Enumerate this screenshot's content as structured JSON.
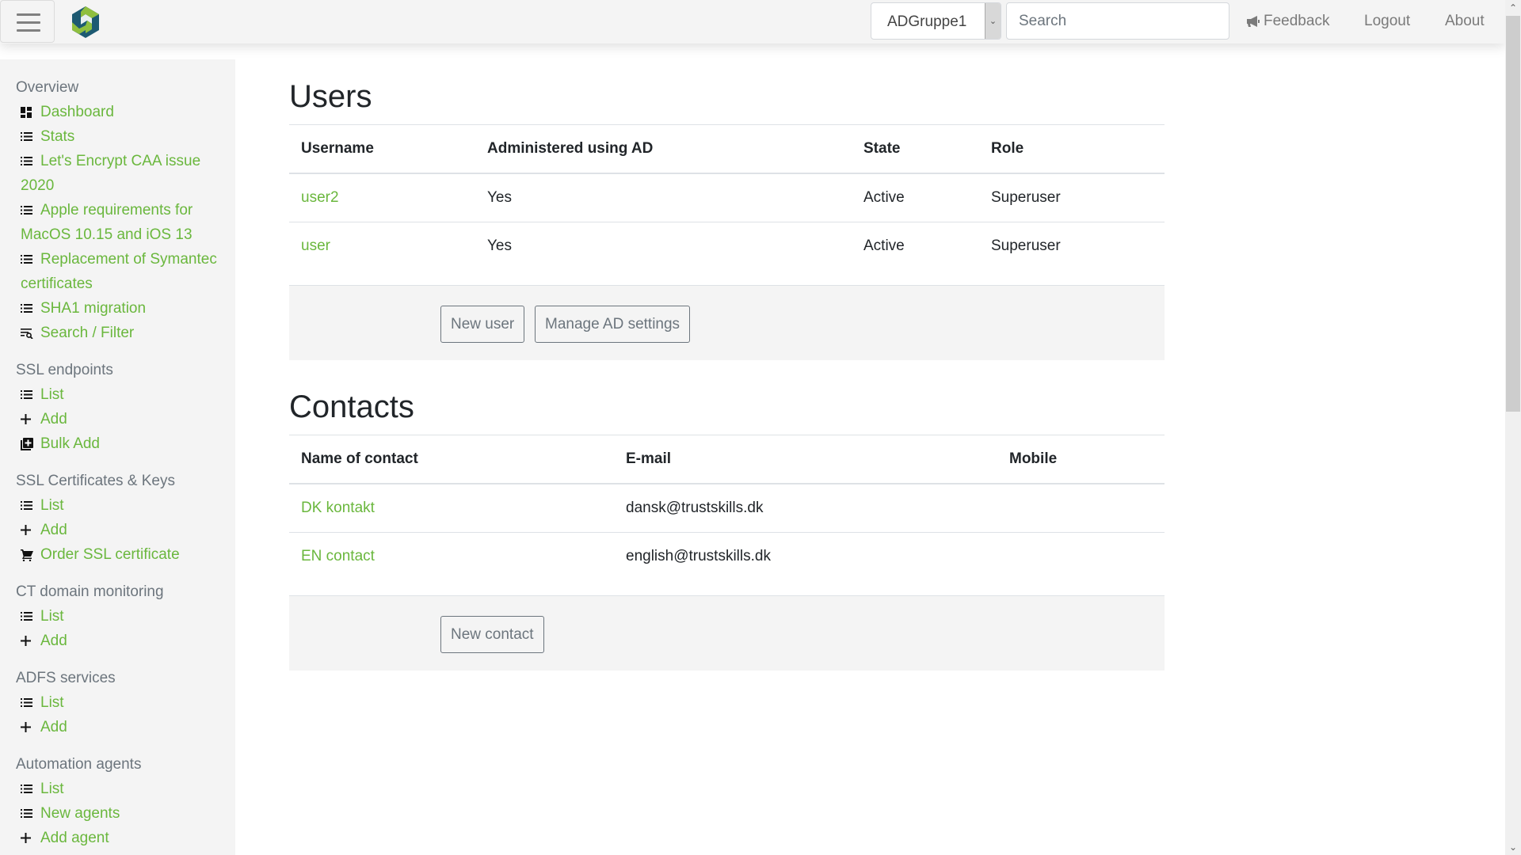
{
  "navbar": {
    "group_select": {
      "value": "ADGruppe1"
    },
    "search": {
      "placeholder": "Search",
      "value": ""
    },
    "links": {
      "feedback": "Feedback",
      "logout": "Logout",
      "about": "About"
    }
  },
  "colors": {
    "link_green": "#6ab73d",
    "sidebar_bg": "#f4f4f4",
    "heading_gray": "#6c757d",
    "logo_blue": "#1d5a72",
    "logo_green": "#8fbf3f"
  },
  "sidebar": {
    "sections": [
      {
        "heading": "Overview",
        "items": [
          {
            "icon": "dashboard-icon",
            "label": "Dashboard"
          },
          {
            "icon": "list-icon",
            "label": "Stats"
          },
          {
            "icon": "list-icon",
            "label": "Let's Encrypt CAA issue 2020"
          },
          {
            "icon": "list-icon",
            "label": "Apple requirements for MacOS 10.15 and iOS 13"
          },
          {
            "icon": "list-icon",
            "label": "Replacement of Symantec certificates"
          },
          {
            "icon": "list-icon",
            "label": "SHA1 migration"
          },
          {
            "icon": "search-filter-icon",
            "label": "Search / Filter"
          }
        ]
      },
      {
        "heading": "SSL endpoints",
        "items": [
          {
            "icon": "list-icon",
            "label": "List"
          },
          {
            "icon": "plus-icon",
            "label": "Add"
          },
          {
            "icon": "bulk-add-icon",
            "label": "Bulk Add"
          }
        ]
      },
      {
        "heading": "SSL Certificates & Keys",
        "items": [
          {
            "icon": "list-icon",
            "label": "List"
          },
          {
            "icon": "plus-icon",
            "label": "Add"
          },
          {
            "icon": "cart-icon",
            "label": "Order SSL certificate"
          }
        ]
      },
      {
        "heading": "CT domain monitoring",
        "items": [
          {
            "icon": "list-icon",
            "label": "List"
          },
          {
            "icon": "plus-icon",
            "label": "Add"
          }
        ]
      },
      {
        "heading": "ADFS services",
        "items": [
          {
            "icon": "list-icon",
            "label": "List"
          },
          {
            "icon": "plus-icon",
            "label": "Add"
          }
        ]
      },
      {
        "heading": "Automation agents",
        "items": [
          {
            "icon": "list-icon",
            "label": "List"
          },
          {
            "icon": "list-icon",
            "label": "New agents"
          },
          {
            "icon": "plus-icon",
            "label": "Add agent"
          }
        ]
      }
    ]
  },
  "users": {
    "title": "Users",
    "columns": [
      "Username",
      "Administered using AD",
      "State",
      "Role"
    ],
    "rows": [
      {
        "username": "user2",
        "ad": "Yes",
        "state": "Active",
        "role": "Superuser"
      },
      {
        "username": "user",
        "ad": "Yes",
        "state": "Active",
        "role": "Superuser"
      }
    ],
    "buttons": {
      "new_user": "New user",
      "manage_ad": "Manage AD settings"
    }
  },
  "contacts": {
    "title": "Contacts",
    "columns": [
      "Name of contact",
      "E-mail",
      "Mobile"
    ],
    "rows": [
      {
        "name": "DK kontakt",
        "email": "dansk@trustskills.dk",
        "mobile": ""
      },
      {
        "name": "EN contact",
        "email": "english@trustskills.dk",
        "mobile": ""
      }
    ],
    "buttons": {
      "new_contact": "New contact"
    }
  }
}
